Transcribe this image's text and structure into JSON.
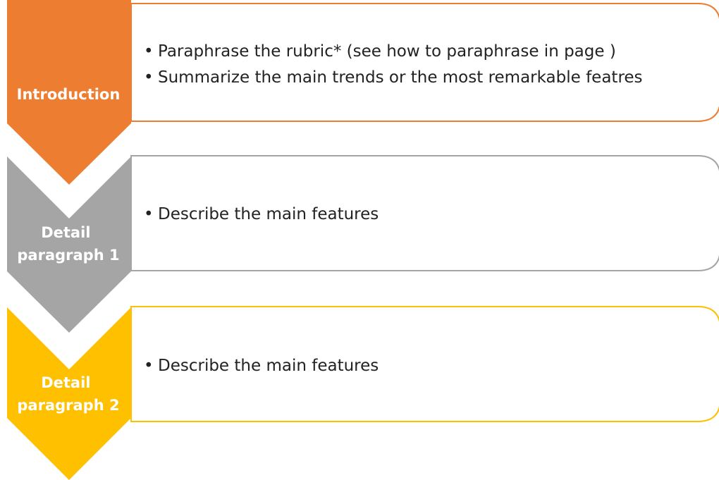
{
  "steps": [
    {
      "label_lines": [
        "Introduction"
      ],
      "color": "#ED7D31",
      "bullets": [
        "Paraphrase the rubric* (see how to paraphrase in page )",
        "Summarize the main trends or the most remarkable featres"
      ]
    },
    {
      "label_lines": [
        "Detail",
        "paragraph 1"
      ],
      "color": "#A5A5A5",
      "bullets": [
        "Describe the main features"
      ]
    },
    {
      "label_lines": [
        "Detail",
        "paragraph 2"
      ],
      "color": "#FFC000",
      "bullets": [
        "Describe the main features"
      ]
    }
  ],
  "bullet_glyph": "•"
}
